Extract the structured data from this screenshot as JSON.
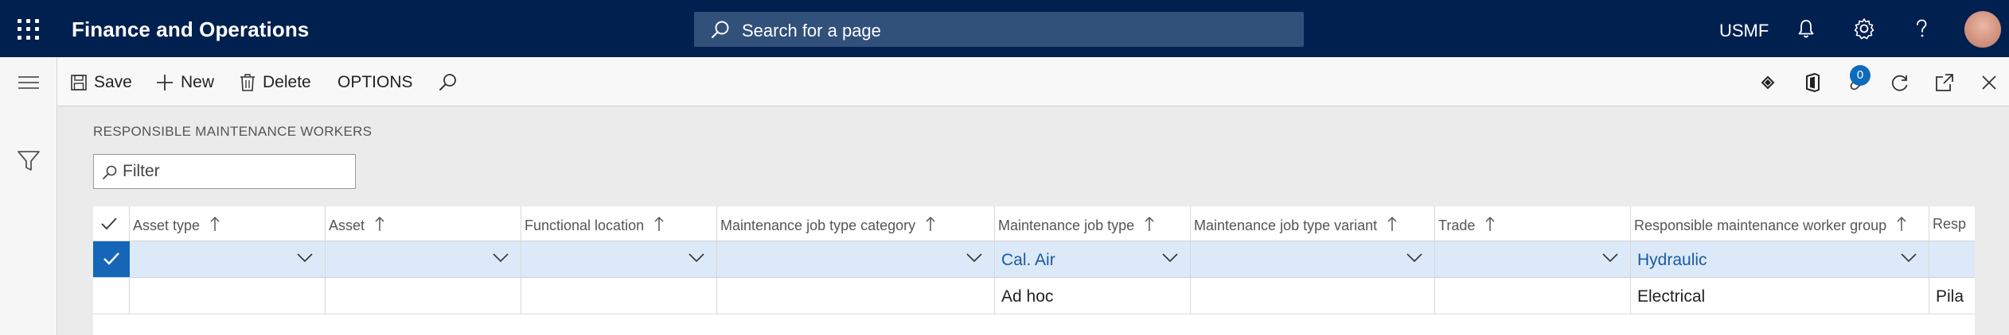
{
  "app": {
    "title": "Finance and Operations",
    "search_placeholder": "Search for a page",
    "company": "USMF"
  },
  "actions": {
    "save": "Save",
    "new": "New",
    "delete": "Delete",
    "options": "OPTIONS",
    "notification_count": "0"
  },
  "page": {
    "section_title": "RESPONSIBLE MAINTENANCE WORKERS",
    "filter_placeholder": "Filter"
  },
  "grid": {
    "columns": [
      "Asset type",
      "Asset",
      "Functional location",
      "Maintenance job type category",
      "Maintenance job type",
      "Maintenance job type variant",
      "Trade",
      "Responsible maintenance worker group",
      "Resp"
    ],
    "rows": [
      {
        "selected": true,
        "asset_type": "",
        "asset": "",
        "functional_location": "",
        "job_type_category": "",
        "job_type": "Cal. Air",
        "job_type_variant": "",
        "trade": "",
        "worker_group": "Hydraulic",
        "responsible": ""
      },
      {
        "selected": false,
        "asset_type": "",
        "asset": "",
        "functional_location": "",
        "job_type_category": "",
        "job_type": "Ad hoc",
        "job_type_variant": "",
        "trade": "",
        "worker_group": "Electrical",
        "responsible": "Pila"
      }
    ]
  },
  "colors": {
    "nav_bg": "#002050",
    "search_bg": "#31507a",
    "selected_row": "#dce9f8",
    "accent": "#1566b7",
    "link": "#1a5aa3"
  }
}
